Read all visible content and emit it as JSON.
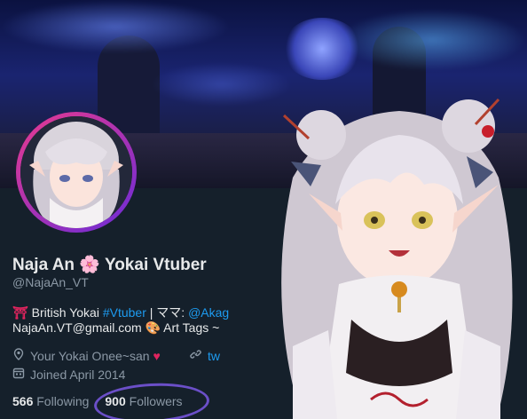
{
  "profile": {
    "display_name": "Naja An",
    "display_name_suffix": "Yokai Vtuber",
    "flower_glyph": "🌸",
    "handle": "@NajaAn_VT",
    "bio": {
      "torii_glyph": "⛩",
      "part1": "British Yokai ",
      "hashtag": "#Vtuber",
      "part2": " | ママ: ",
      "mention": "@Akag",
      "email": "NajaAn.VT@gmail.com",
      "palette_glyph": "🎨",
      "art_tags": "Art Tags ~ "
    },
    "location": "Your Yokai Onee~san",
    "location_heart": "♥",
    "website": "tw",
    "joined": "Joined April 2014",
    "following_count": "566",
    "following_label": "Following",
    "followers_count": "900",
    "followers_label": "Followers"
  },
  "icons": {
    "location": "map-pin-icon",
    "link": "link-icon",
    "calendar": "calendar-icon"
  },
  "colors": {
    "background": "#15202b",
    "link": "#1d9bf0",
    "muted": "#8b98a5",
    "text": "#e7e9ea",
    "avatar_ring_start": "#e93a8e",
    "avatar_ring_end": "#6a2bd8",
    "annotation_circle": "#6b4fc8"
  }
}
